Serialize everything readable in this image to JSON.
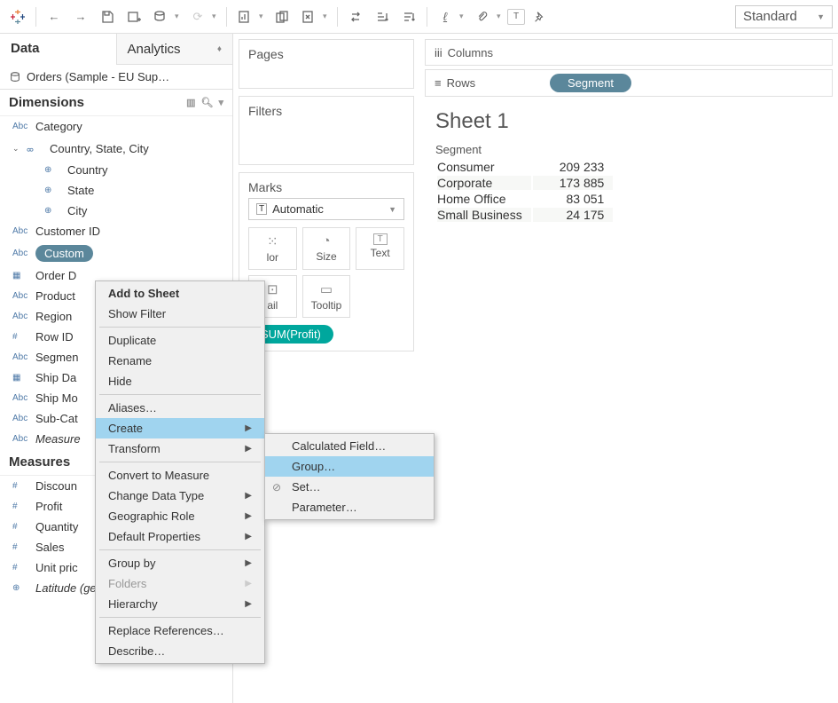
{
  "toolbar": {
    "view_mode": "Standard"
  },
  "tabs": {
    "data": "Data",
    "analytics": "Analytics"
  },
  "datasource": "Orders (Sample - EU Sup…",
  "dimensions": {
    "header": "Dimensions",
    "items": [
      {
        "type": "Abc",
        "label": "Category"
      },
      {
        "type": "geo",
        "label": "Country, State, City",
        "expanded": true,
        "children": [
          {
            "type": "globe",
            "label": "Country"
          },
          {
            "type": "globe",
            "label": "State"
          },
          {
            "type": "globe",
            "label": "City"
          }
        ]
      },
      {
        "type": "Abc",
        "label": "Customer ID"
      },
      {
        "type": "Abc",
        "label": "Custom",
        "selected": true
      },
      {
        "type": "date",
        "label": "Order D"
      },
      {
        "type": "Abc",
        "label": "Product"
      },
      {
        "type": "Abc",
        "label": "Region"
      },
      {
        "type": "hash",
        "label": "Row ID"
      },
      {
        "type": "Abc",
        "label": "Segmen"
      },
      {
        "type": "date",
        "label": "Ship Da"
      },
      {
        "type": "Abc",
        "label": "Ship Mo"
      },
      {
        "type": "Abc",
        "label": "Sub-Cat"
      },
      {
        "type": "Abc",
        "label": "Measure",
        "italic": true
      }
    ]
  },
  "measures": {
    "header": "Measures",
    "items": [
      {
        "type": "hash",
        "label": "Discoun"
      },
      {
        "type": "hash",
        "label": "Profit"
      },
      {
        "type": "hash",
        "label": "Quantity"
      },
      {
        "type": "hash",
        "label": "Sales"
      },
      {
        "type": "hash",
        "label": "Unit pric"
      },
      {
        "type": "globe",
        "label": "Latitude (generated)",
        "italic": true
      }
    ]
  },
  "cards": {
    "pages": "Pages",
    "filters": "Filters",
    "marks": "Marks",
    "marks_type": "Automatic",
    "marks_buttons": {
      "color": "lor",
      "size": "Size",
      "text": "Text",
      "detail": "ail",
      "tooltip": "Tooltip"
    },
    "marks_pill": "SUM(Profit)"
  },
  "shelves": {
    "columns": "Columns",
    "rows": "Rows",
    "rows_pill": "Segment"
  },
  "sheet": {
    "title": "Sheet 1",
    "header": "Segment",
    "rows": [
      {
        "label": "Consumer",
        "value": "209 233"
      },
      {
        "label": "Corporate",
        "value": "173 885"
      },
      {
        "label": "Home Office",
        "value": "83 051"
      },
      {
        "label": "Small Business",
        "value": "24 175"
      }
    ]
  },
  "ctx": {
    "add": "Add to Sheet",
    "show": "Show Filter",
    "dup": "Duplicate",
    "ren": "Rename",
    "hide": "Hide",
    "aliases": "Aliases…",
    "create": "Create",
    "transform": "Transform",
    "convert": "Convert to Measure",
    "cdt": "Change Data Type",
    "geo": "Geographic Role",
    "defp": "Default Properties",
    "grp": "Group by",
    "folders": "Folders",
    "hier": "Hierarchy",
    "replace": "Replace References…",
    "desc": "Describe…"
  },
  "subctx": {
    "calc": "Calculated Field…",
    "group": "Group…",
    "set": "Set…",
    "param": "Parameter…"
  }
}
